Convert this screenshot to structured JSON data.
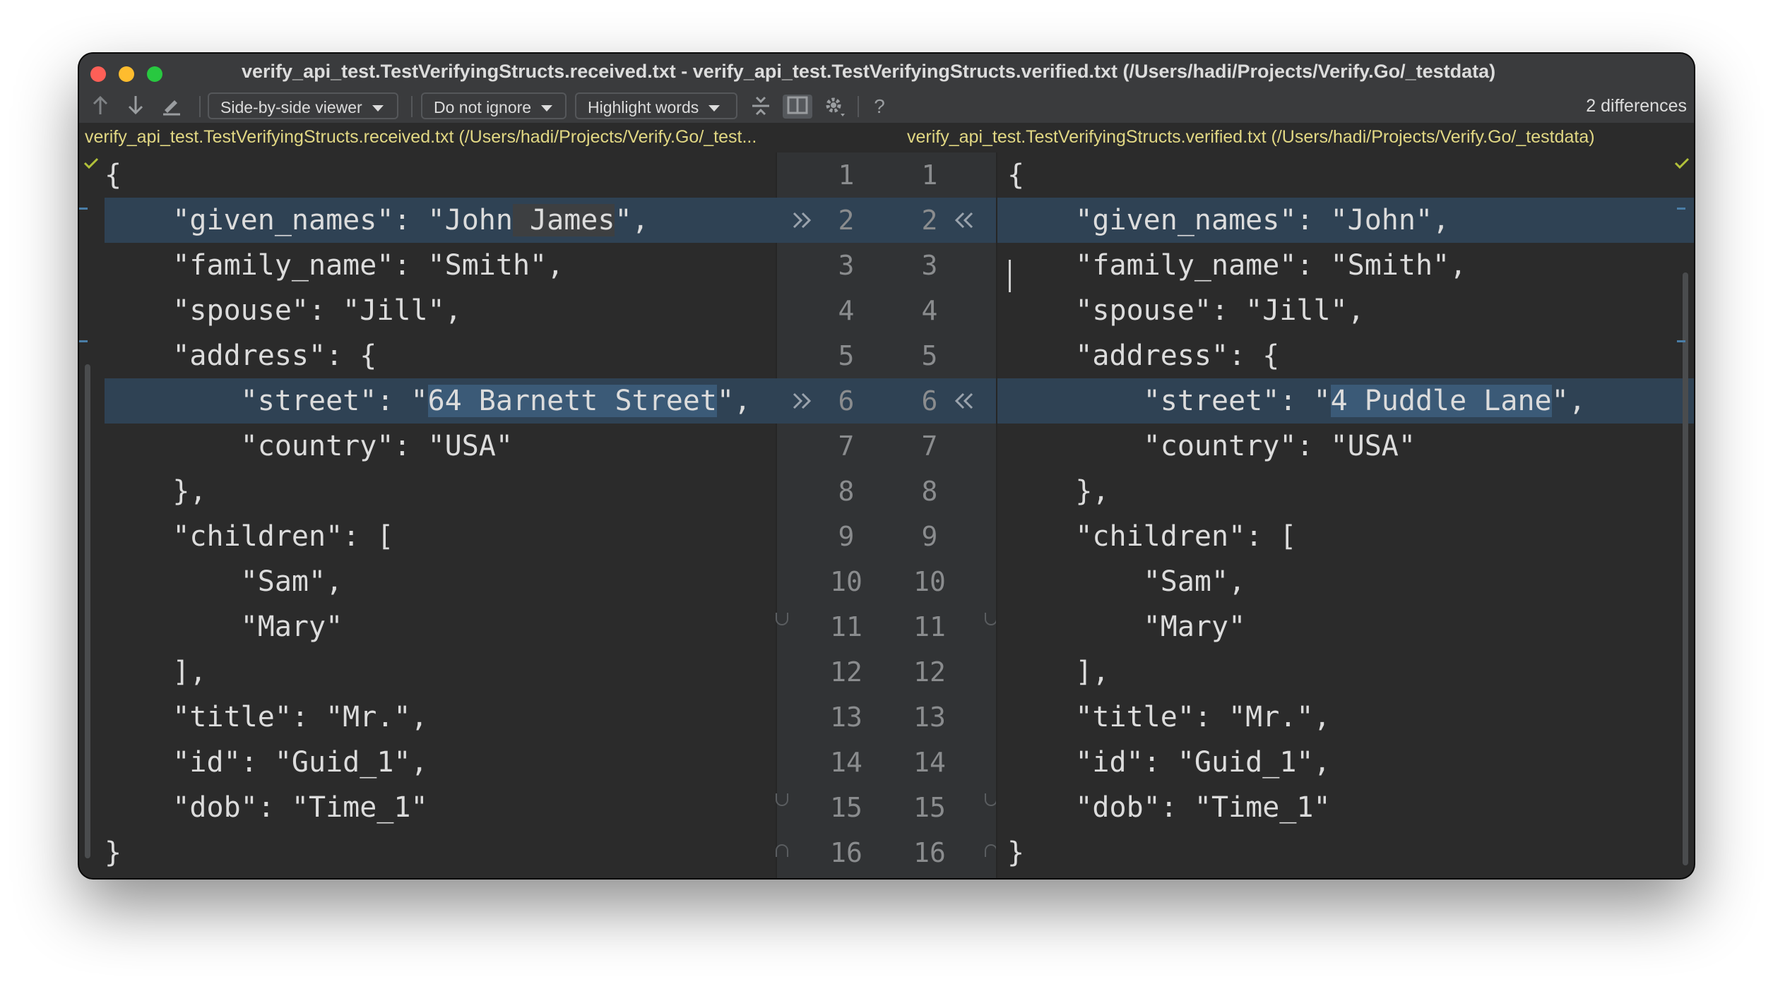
{
  "window": {
    "title": "verify_api_test.TestVerifyingStructs.received.txt - verify_api_test.TestVerifyingStructs.verified.txt (/Users/hadi/Projects/Verify.Go/_testdata)"
  },
  "toolbar": {
    "viewer_label": "Side-by-side viewer",
    "ignore_label": "Do not ignore",
    "highlight_label": "Highlight words",
    "help_label": "?",
    "differences": "2 differences"
  },
  "files": {
    "left_path": "verify_api_test.TestVerifyingStructs.received.txt (/Users/hadi/Projects/Verify.Go/_test...",
    "right_path": "verify_api_test.TestVerifyingStructs.verified.txt (/Users/hadi/Projects/Verify.Go/_testdata)"
  },
  "left": {
    "l1": "{",
    "l2a": "    \"given_names\": \"John",
    "l2b": " James",
    "l2c": "\",",
    "l3": "    \"family_name\": \"Smith\",",
    "l4": "    \"spouse\": \"Jill\",",
    "l5": "    \"address\": {",
    "l6a": "        \"street\": \"",
    "l6b": "64 Barnett Street",
    "l6c": "\",",
    "l7": "        \"country\": \"USA\"",
    "l8": "    },",
    "l9": "    \"children\": [",
    "l10": "        \"Sam\",",
    "l11": "        \"Mary\"",
    "l12": "    ],",
    "l13": "    \"title\": \"Mr.\",",
    "l14": "    \"id\": \"Guid_1\",",
    "l15": "    \"dob\": \"Time_1\"",
    "l16": "}"
  },
  "right": {
    "l1": "{",
    "l2a": "    \"given_names\": \"John",
    "l2c": "\",",
    "l3": "    \"family_name\": \"Smith\",",
    "l4": "    \"spouse\": \"Jill\",",
    "l5": "    \"address\": {",
    "l6a": "        \"street\": \"",
    "l6b": "4 Puddle Lane",
    "l6c": "\",",
    "l7": "        \"country\": \"USA\"",
    "l8": "    },",
    "l9": "    \"children\": [",
    "l10": "        \"Sam\",",
    "l11": "        \"Mary\"",
    "l12": "    ],",
    "l13": "    \"title\": \"Mr.\",",
    "l14": "    \"id\": \"Guid_1\",",
    "l15": "    \"dob\": \"Time_1\"",
    "l16": "}"
  },
  "line_numbers": [
    "1",
    "2",
    "3",
    "4",
    "5",
    "6",
    "7",
    "8",
    "9",
    "10",
    "11",
    "12",
    "13",
    "14",
    "15",
    "16"
  ],
  "icons": {
    "prev_diff": "arrow-up-icon",
    "next_diff": "arrow-down-icon",
    "edit": "pencil-icon",
    "collapse": "collapse-unchanged-icon",
    "sync_scroll": "sync-scroll-icon",
    "settings": "gear-icon",
    "apply_left": "double-chevron-right-icon",
    "apply_right": "double-chevron-left-icon"
  },
  "colors": {
    "background": "#2b2b2b",
    "changed_line": "#2f4254",
    "changed_word": "#3b5a77",
    "path_text": "#e1d783"
  }
}
